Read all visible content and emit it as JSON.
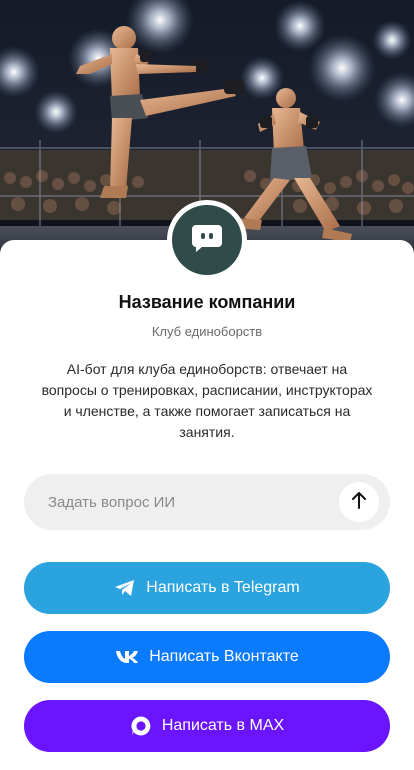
{
  "company": {
    "title": "Название компании",
    "subtitle": "Клуб единоборств",
    "description": "AI-бот для клуба единоборств: отвечает на вопросы о тренировках, расписании, инструкторах и членстве, а также помогает записаться на занятия."
  },
  "ask": {
    "placeholder": "Задать вопрос ИИ",
    "send_icon": "arrow-up-icon"
  },
  "buttons": {
    "telegram": {
      "label": "Написать в Telegram",
      "icon": "telegram-icon",
      "color": "#2ba3df"
    },
    "vk": {
      "label": "Написать Вконтакте",
      "icon": "vk-icon",
      "color": "#0a7aff"
    },
    "max": {
      "label": "Написать в MAX",
      "icon": "max-icon",
      "color": "#6a14ff"
    }
  },
  "colors": {
    "avatar_bg": "#2f4b4a",
    "input_bg": "#efefef"
  }
}
